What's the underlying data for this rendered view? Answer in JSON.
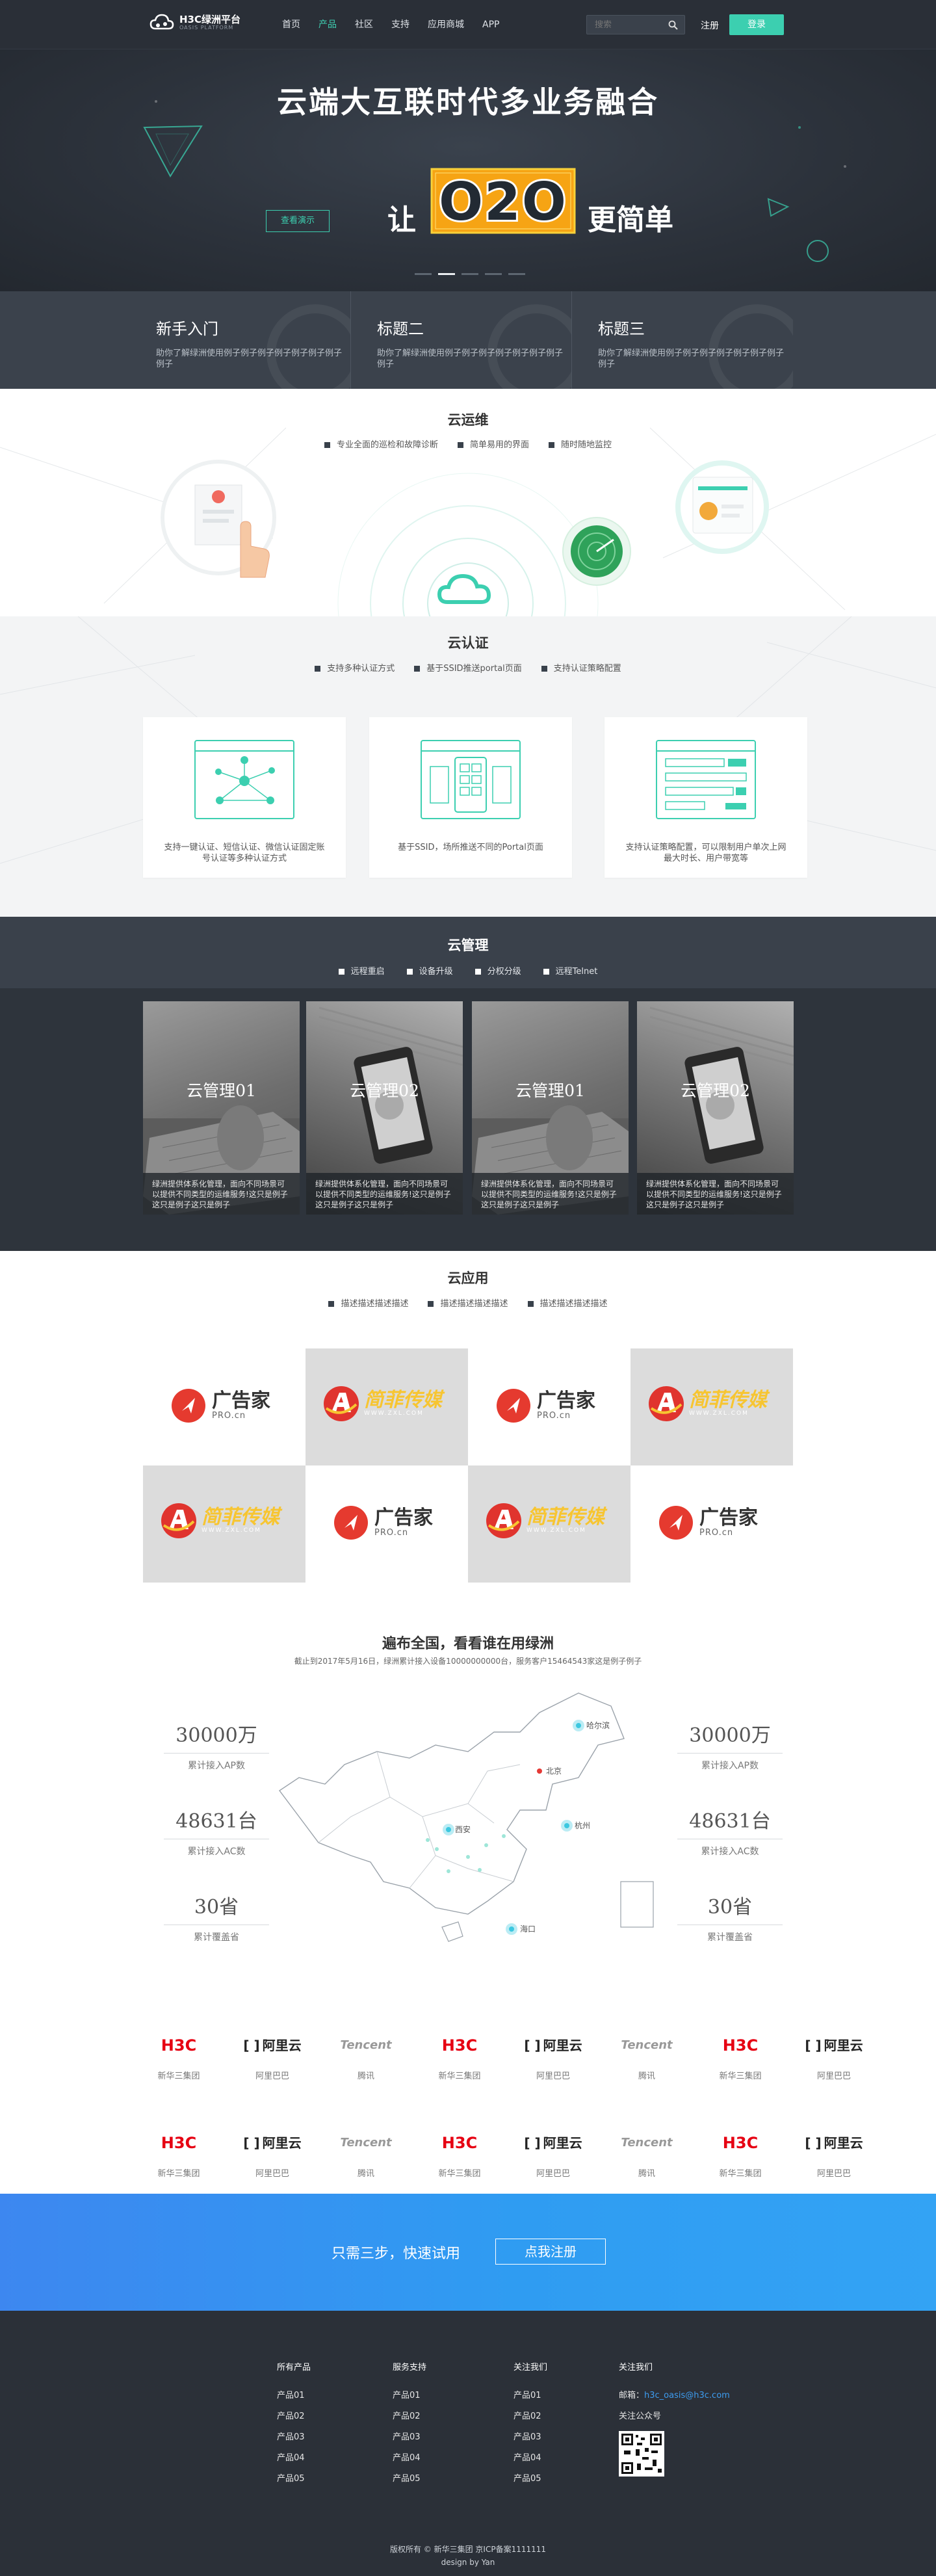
{
  "nav": {
    "logo_title": "H3C绿洲平台",
    "logo_sub": "OASIS PLATFORM",
    "menu": [
      "首页",
      "产品",
      "社区",
      "支持",
      "应用商城",
      "APP"
    ],
    "active_index": 1,
    "search_placeholder": "搜索",
    "register": "注册",
    "login": "登录"
  },
  "hero": {
    "title": "云端大互联时代多业务融合",
    "demo_button": "查看演示",
    "prefix": "让",
    "highlight": "O2O",
    "suffix": "更简单",
    "slides": 5,
    "active_slide": 1
  },
  "features": [
    {
      "title": "新手入门",
      "desc": "助你了解绿洲使用例子例子例子例子例子例子例子例子"
    },
    {
      "title": "标题二",
      "desc": "助你了解绿洲使用例子例子例子例子例子例子例子例子"
    },
    {
      "title": "标题三",
      "desc": "助你了解绿洲使用例子例子例子例子例子例子例子例子"
    }
  ],
  "yunwei": {
    "title": "云运维",
    "bullets": [
      "专业全面的巡检和故障诊断",
      "简单易用的界面",
      "随时随地监控"
    ]
  },
  "renzheng": {
    "title": "云认证",
    "bullets": [
      "支持多种认证方式",
      "基于SSID推送portal页面",
      "支持认证策略配置"
    ],
    "cards": [
      "支持一键认证、短信认证、微信认证固定账号认证等多种认证方式",
      "基于SSID，场所推送不同的Portal页面",
      "支持认证策略配置，可以限制用户单次上网最大时长、用户带宽等"
    ]
  },
  "guanli": {
    "title": "云管理",
    "bullets": [
      "远程重启",
      "设备升级",
      "分权分级",
      "远程Telnet"
    ],
    "cards": [
      {
        "title": "云管理01",
        "desc": "绿洲提供体系化管理，面向不同场景可以提供不同类型的运维服务!这只是例子这只是例子这只是例子"
      },
      {
        "title": "云管理02",
        "desc": "绿洲提供体系化管理，面向不同场景可以提供不同类型的运维服务!这只是例子这只是例子这只是例子"
      },
      {
        "title": "云管理01",
        "desc": "绿洲提供体系化管理，面向不同场景可以提供不同类型的运维服务!这只是例子这只是例子这只是例子"
      },
      {
        "title": "云管理02",
        "desc": "绿洲提供体系化管理，面向不同场景可以提供不同类型的运维服务!这只是例子这只是例子这只是例子"
      }
    ]
  },
  "yingyong": {
    "title": "云应用",
    "bullets": [
      "描述描述描述描述",
      "描述描述描述描述",
      "描述描述描述描述"
    ],
    "apps": [
      {
        "type": "ggj",
        "name": "广告家",
        "sub": "PRO.cn"
      },
      {
        "type": "jf",
        "name": "简菲传媒",
        "sub": "WWW.ZXL.COM"
      },
      {
        "type": "ggj",
        "name": "广告家",
        "sub": "PRO.cn"
      },
      {
        "type": "jf",
        "name": "简菲传媒",
        "sub": "WWW.ZXL.COM"
      },
      {
        "type": "jf",
        "name": "简菲传媒",
        "sub": "WWW.ZXL.COM"
      },
      {
        "type": "ggj",
        "name": "广告家",
        "sub": "PRO.cn"
      },
      {
        "type": "jf",
        "name": "简菲传媒",
        "sub": "WWW.ZXL.COM"
      },
      {
        "type": "ggj",
        "name": "广告家",
        "sub": "PRO.cn"
      }
    ]
  },
  "map": {
    "title": "遍布全国，看看谁在用绿洲",
    "subtitle": "截止到2017年5月16日，绿洲累计接入设备10000000000台，服务客户15464543家这是例子例子",
    "stats_left": [
      {
        "num": "30000万",
        "label": "累计接入AP数"
      },
      {
        "num": "48631台",
        "label": "累计接入AC数"
      },
      {
        "num": "30省",
        "label": "累计覆盖省"
      }
    ],
    "stats_right": [
      {
        "num": "30000万",
        "label": "累计接入AP数"
      },
      {
        "num": "48631台",
        "label": "累计接入AC数"
      },
      {
        "num": "30省",
        "label": "累计覆盖省"
      }
    ],
    "cities": [
      "哈尔滨",
      "北京",
      "西安",
      "杭州",
      "海口"
    ]
  },
  "partners": [
    {
      "logo": "H3C",
      "name": "新华三集团"
    },
    {
      "logo": "阿里云",
      "name": "阿里巴巴"
    },
    {
      "logo": "Tencent",
      "name": "腾讯"
    },
    {
      "logo": "H3C",
      "name": "新华三集团"
    },
    {
      "logo": "阿里云",
      "name": "阿里巴巴"
    },
    {
      "logo": "Tencent",
      "name": "腾讯"
    },
    {
      "logo": "H3C",
      "name": "新华三集团"
    },
    {
      "logo": "阿里云",
      "name": "阿里巴巴"
    },
    {
      "logo": "H3C",
      "name": "新华三集团"
    },
    {
      "logo": "阿里云",
      "name": "阿里巴巴"
    },
    {
      "logo": "Tencent",
      "name": "腾讯"
    },
    {
      "logo": "H3C",
      "name": "新华三集团"
    },
    {
      "logo": "阿里云",
      "name": "阿里巴巴"
    },
    {
      "logo": "Tencent",
      "name": "腾讯"
    },
    {
      "logo": "H3C",
      "name": "新华三集团"
    },
    {
      "logo": "阿里云",
      "name": "阿里巴巴"
    }
  ],
  "cta": {
    "text": "只需三步，快速试用",
    "button": "点我注册"
  },
  "footer": {
    "cols": [
      {
        "title": "所有产品",
        "items": [
          "产品01",
          "产品02",
          "产品03",
          "产品04",
          "产品05"
        ]
      },
      {
        "title": "服务支持",
        "items": [
          "产品01",
          "产品02",
          "产品03",
          "产品04",
          "产品05"
        ]
      },
      {
        "title": "关注我们",
        "items": [
          "产品01",
          "产品02",
          "产品03",
          "产品04",
          "产品05"
        ]
      }
    ],
    "contact_title": "关注我们",
    "email_label": "邮箱：",
    "email": "h3c_oasis@h3c.com",
    "wechat": "关注公众号",
    "copyright": "版权所有 © 新华三集团 京ICP备案1111111",
    "design": "design by Yan"
  },
  "colors": {
    "accent": "#3ccfb0",
    "dark": "#2a2f37",
    "blue": "#3d8ef0",
    "h3c_red": "#e60012",
    "ali_black": "#222",
    "tencent_gray": "#999"
  }
}
